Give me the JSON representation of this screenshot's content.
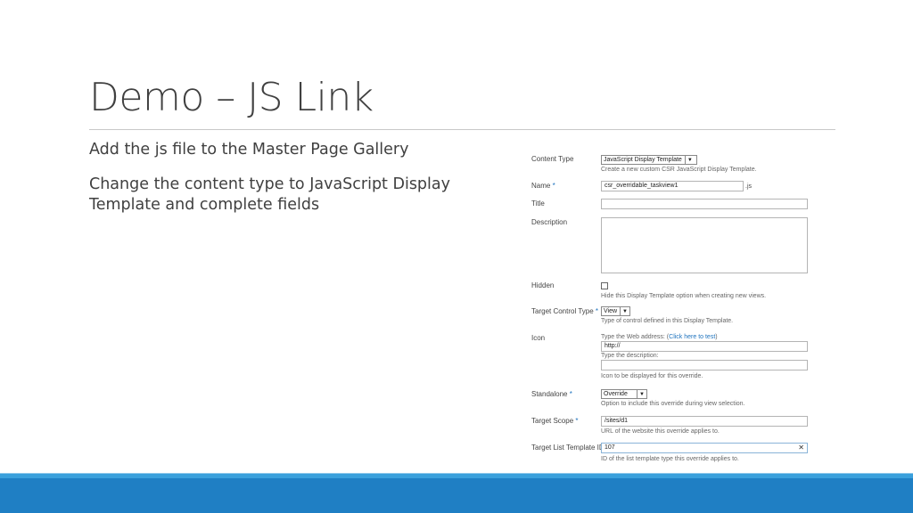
{
  "slide": {
    "title": "Demo – JS Link",
    "bullets": [
      "Add the js file to the Master Page Gallery",
      "Change the content type to JavaScript Display Template and complete fields"
    ]
  },
  "form": {
    "content_type": {
      "label": "Content Type",
      "value": "JavaScript Display Template",
      "hint": "Create a new custom CSR JavaScript Display Template."
    },
    "name": {
      "label": "Name",
      "required_mark": "*",
      "value": "csr_overridable_taskview1",
      "suffix": ".js"
    },
    "title": {
      "label": "Title",
      "value": ""
    },
    "description": {
      "label": "Description",
      "value": ""
    },
    "hidden": {
      "label": "Hidden",
      "checked": false,
      "hint": "Hide this Display Template option when creating new views."
    },
    "target_control_type": {
      "label": "Target Control Type",
      "required_mark": "*",
      "value": "View",
      "hint": "Type of control defined in this Display Template."
    },
    "icon": {
      "label": "Icon",
      "address_prompt_prefix": "Type the Web address: (",
      "address_link": "Click here to test",
      "address_prompt_suffix": ")",
      "url_value": "http://",
      "description_prompt": "Type the description:",
      "description_value": "",
      "hint": "Icon to be displayed for this override."
    },
    "standalone": {
      "label": "Standalone",
      "required_mark": "*",
      "value": "Override",
      "hint": "Option to include this override during view selection."
    },
    "target_scope": {
      "label": "Target Scope",
      "required_mark": "*",
      "value": "/sites/d1",
      "hint": "URL of the website this override applies to."
    },
    "target_list_template_id": {
      "label": "Target List Template ID",
      "value": "107",
      "clear_glyph": "✕",
      "hint": "ID of the list template type this override applies to."
    }
  },
  "colors": {
    "accent": "#1e73be",
    "band": "#1f7fc4",
    "band_light": "#3aa0dc",
    "text": "#404040"
  }
}
